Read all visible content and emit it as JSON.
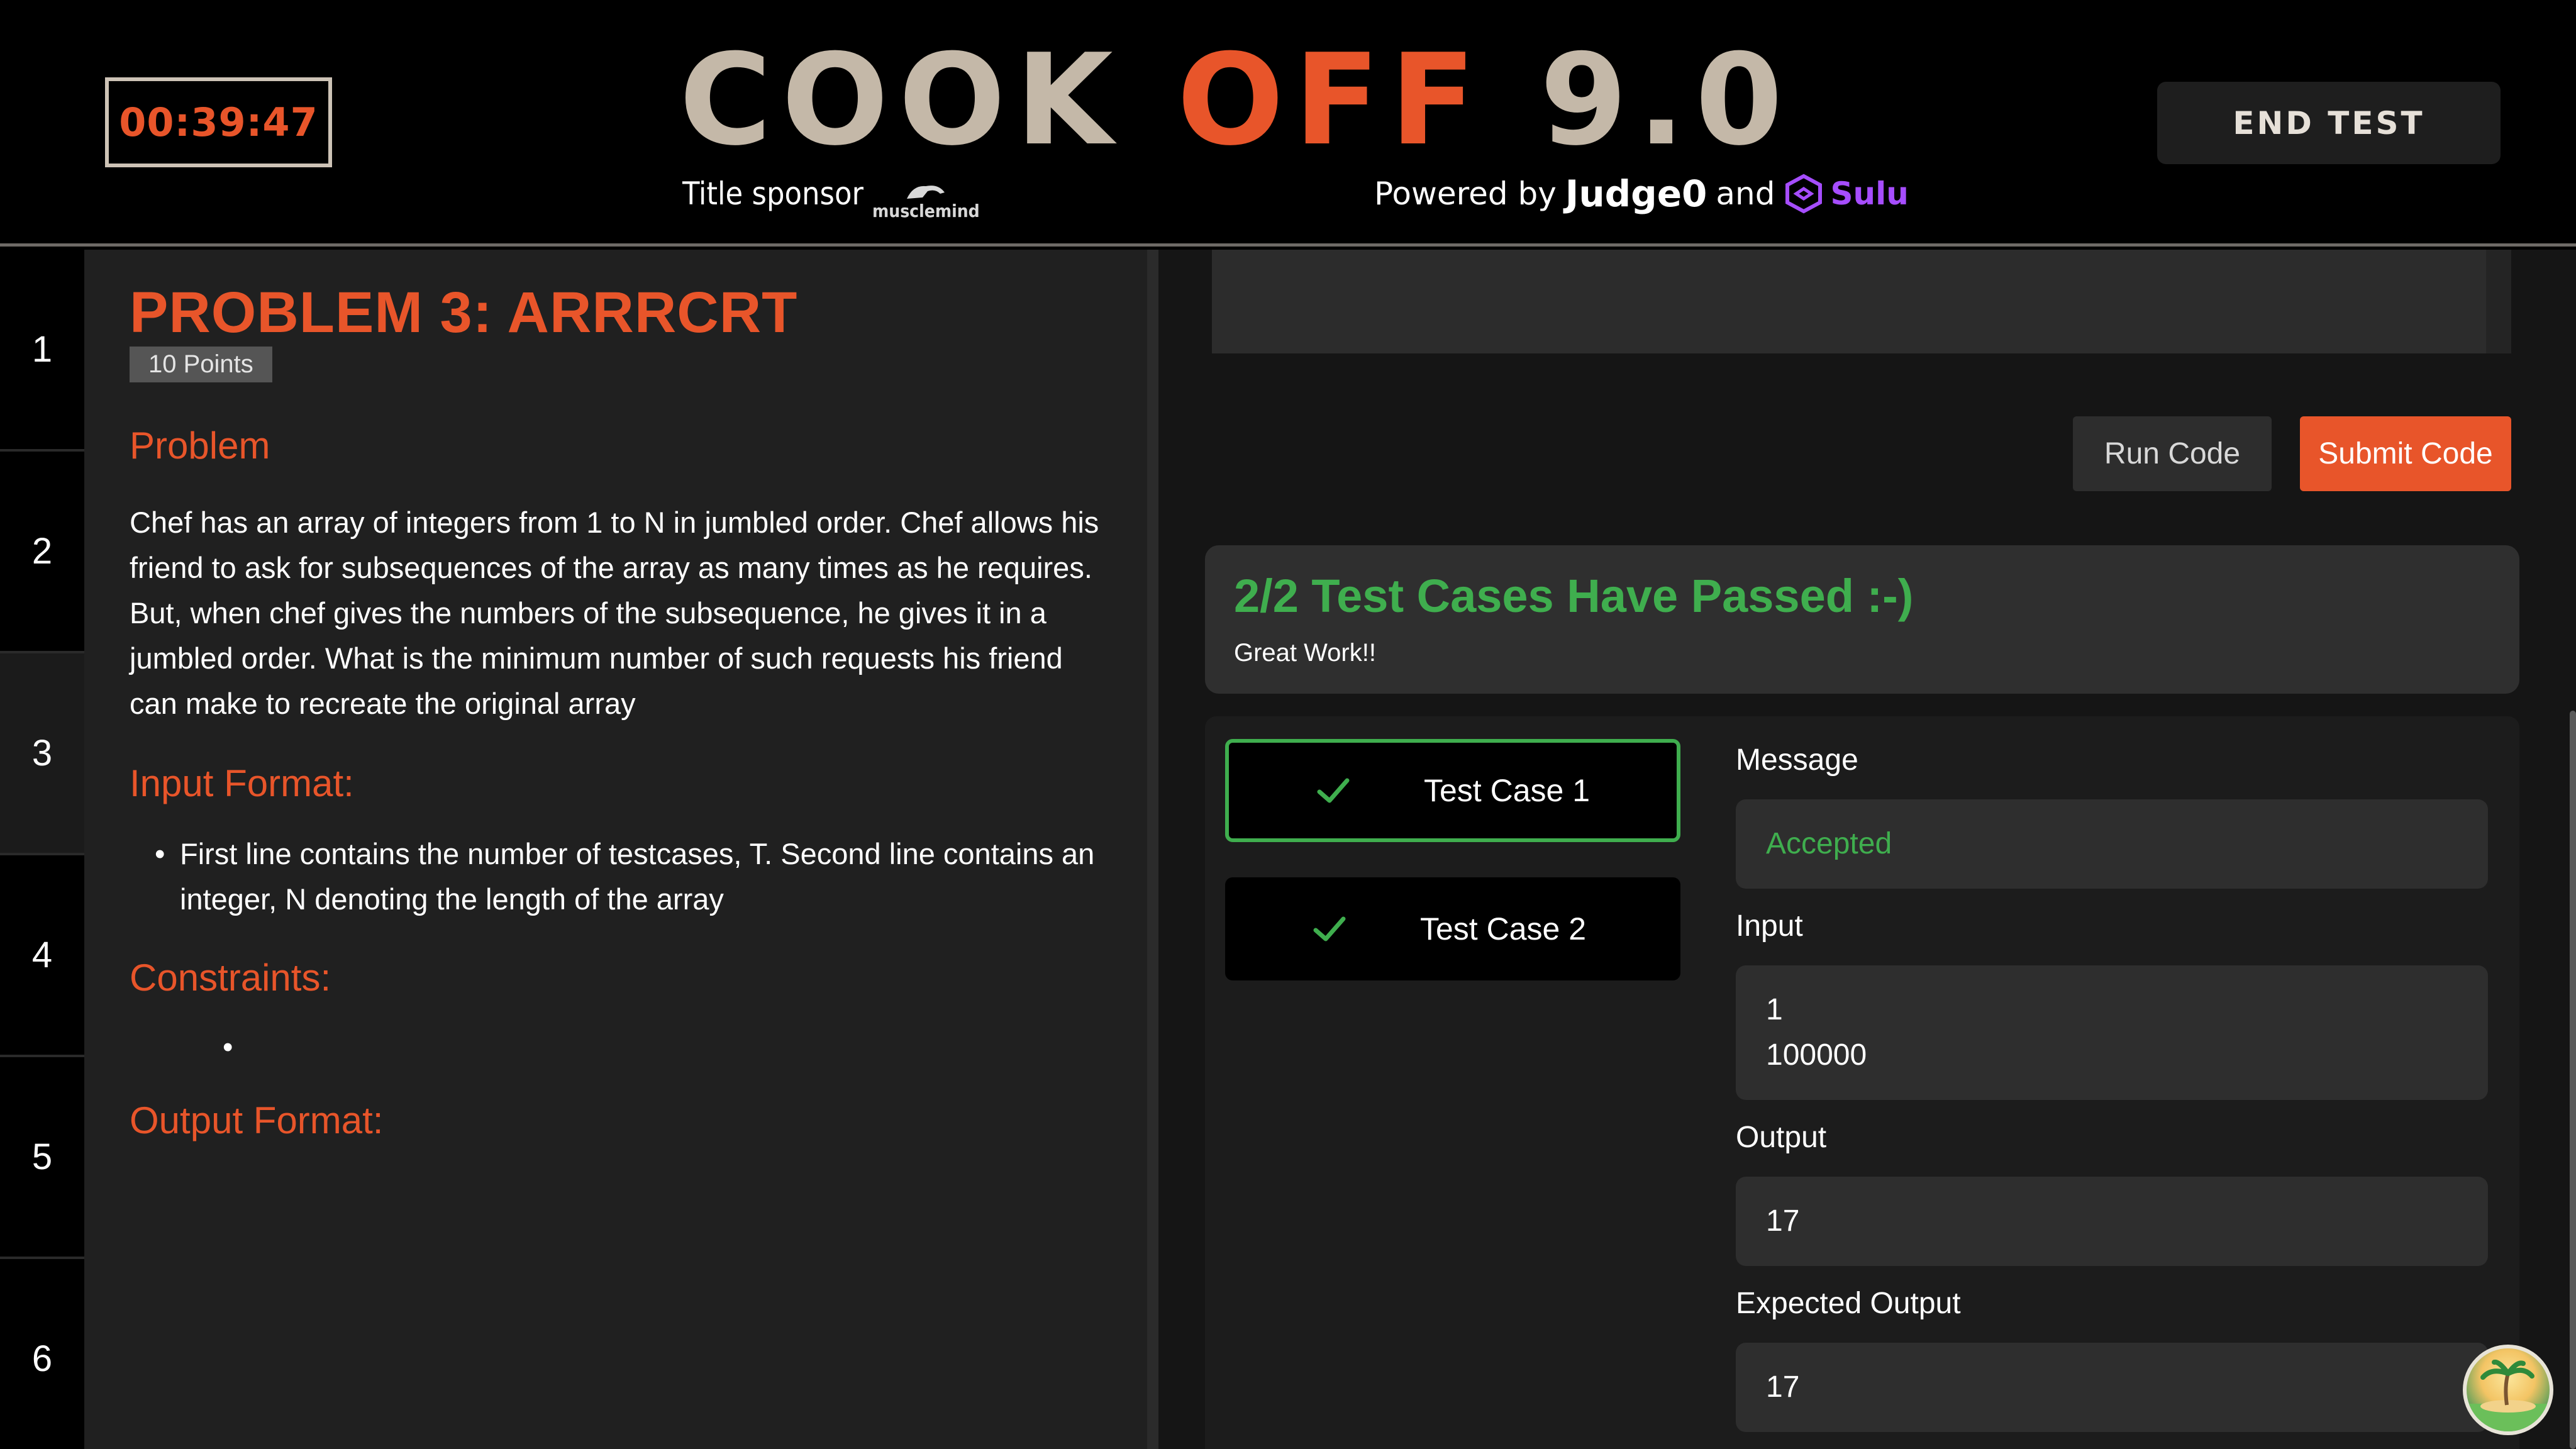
{
  "header": {
    "timer": "00:39:47",
    "logo": {
      "word1": "COOK",
      "word2": "OFF",
      "word3": "9.0"
    },
    "sponsor_label": "Title sponsor",
    "sponsor_brand": "musclemind",
    "powered_prefix": "Powered by",
    "powered_judge": "Judge0",
    "powered_and": "and",
    "powered_sulu": "Sulu",
    "end_test": "END TEST"
  },
  "sidebar": {
    "items": [
      {
        "label": "1"
      },
      {
        "label": "2"
      },
      {
        "label": "3",
        "active": true
      },
      {
        "label": "4"
      },
      {
        "label": "5"
      },
      {
        "label": "6"
      }
    ]
  },
  "problem": {
    "title": "PROBLEM 3: ARRRCRT",
    "points": "10 Points",
    "problem_head": "Problem",
    "problem_text": "Chef has an array of integers from 1 to N in jumbled order. Chef allows his friend to ask for subsequences of the array as many times as he requires. But, when chef gives the numbers of the subsequence, he gives it in a jumbled order. What is the minimum number of such requests his friend can make to recreate the original array",
    "input_head": "Input Format:",
    "input_bullets": [
      "First line contains the number of testcases, T. Second line contains an integer, N denoting the length of the array"
    ],
    "constraints_head": "Constraints:",
    "output_head": "Output Format:"
  },
  "actions": {
    "run": "Run Code",
    "submit": "Submit Code"
  },
  "result": {
    "title": "2/2 Test Cases Have Passed :-)",
    "subtitle": "Great Work!!"
  },
  "test_cases": [
    {
      "label": "Test Case 1",
      "selected": true
    },
    {
      "label": "Test Case 2",
      "selected": false
    }
  ],
  "details": {
    "message_label": "Message",
    "message_value": "Accepted",
    "input_label": "Input",
    "input_line1": "1",
    "input_line2": "100000",
    "output_label": "Output",
    "output_value": "17",
    "expected_label": "Expected Output",
    "expected_value": "17"
  },
  "colors": {
    "accent": "#e8552a",
    "success": "#3fae4e",
    "sulu": "#a64dff"
  }
}
